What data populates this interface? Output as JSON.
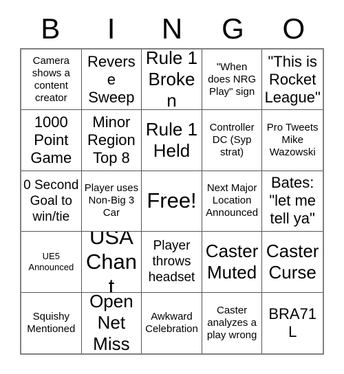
{
  "card": {
    "title": "BINGO",
    "header_letters": [
      "B",
      "I",
      "N",
      "G",
      "O"
    ],
    "grid_size": 5,
    "free_space": "Free!",
    "colors": {
      "background": "#ffffff",
      "text": "#000000",
      "grid_line": "#555555",
      "grid_border": "#808080"
    },
    "rows": [
      [
        {
          "text": "Camera shows a content creator",
          "size": "s"
        },
        {
          "text": "Reverse Sweep",
          "size": "l"
        },
        {
          "text": "Rule 1 Broken",
          "size": "xl"
        },
        {
          "text": "\"When does NRG Play\" sign",
          "size": "s"
        },
        {
          "text": "\"This is Rocket League\"",
          "size": "l"
        }
      ],
      [
        {
          "text": "1000 Point Game",
          "size": "l"
        },
        {
          "text": "Minor Region Top 8",
          "size": "l"
        },
        {
          "text": "Rule 1 Held",
          "size": "xl"
        },
        {
          "text": "Controller DC (Syp strat)",
          "size": "s"
        },
        {
          "text": "Pro Tweets Mike Wazowski",
          "size": "s"
        }
      ],
      [
        {
          "text": "0 Second Goal to win/tie",
          "size": "m"
        },
        {
          "text": "Player uses Non-Big 3 Car",
          "size": "s"
        },
        {
          "text": "Free!",
          "size": "xxl"
        },
        {
          "text": "Next Major Location Announced",
          "size": "s"
        },
        {
          "text": "Bates: \"let me tell ya\"",
          "size": "l"
        }
      ],
      [
        {
          "text": "UE5 Announced",
          "size": "xs"
        },
        {
          "text": "USA Chant",
          "size": "xxl"
        },
        {
          "text": "Player throws headset",
          "size": "m"
        },
        {
          "text": "Caster Muted",
          "size": "xl"
        },
        {
          "text": "Caster Curse",
          "size": "xl"
        }
      ],
      [
        {
          "text": "Squishy Mentioned",
          "size": "s"
        },
        {
          "text": "Open Net Miss",
          "size": "xl"
        },
        {
          "text": "Awkward Celebration",
          "size": "s"
        },
        {
          "text": "Caster analyzes a play wrong",
          "size": "s"
        },
        {
          "text": "BRA71L",
          "size": "l"
        }
      ]
    ]
  }
}
